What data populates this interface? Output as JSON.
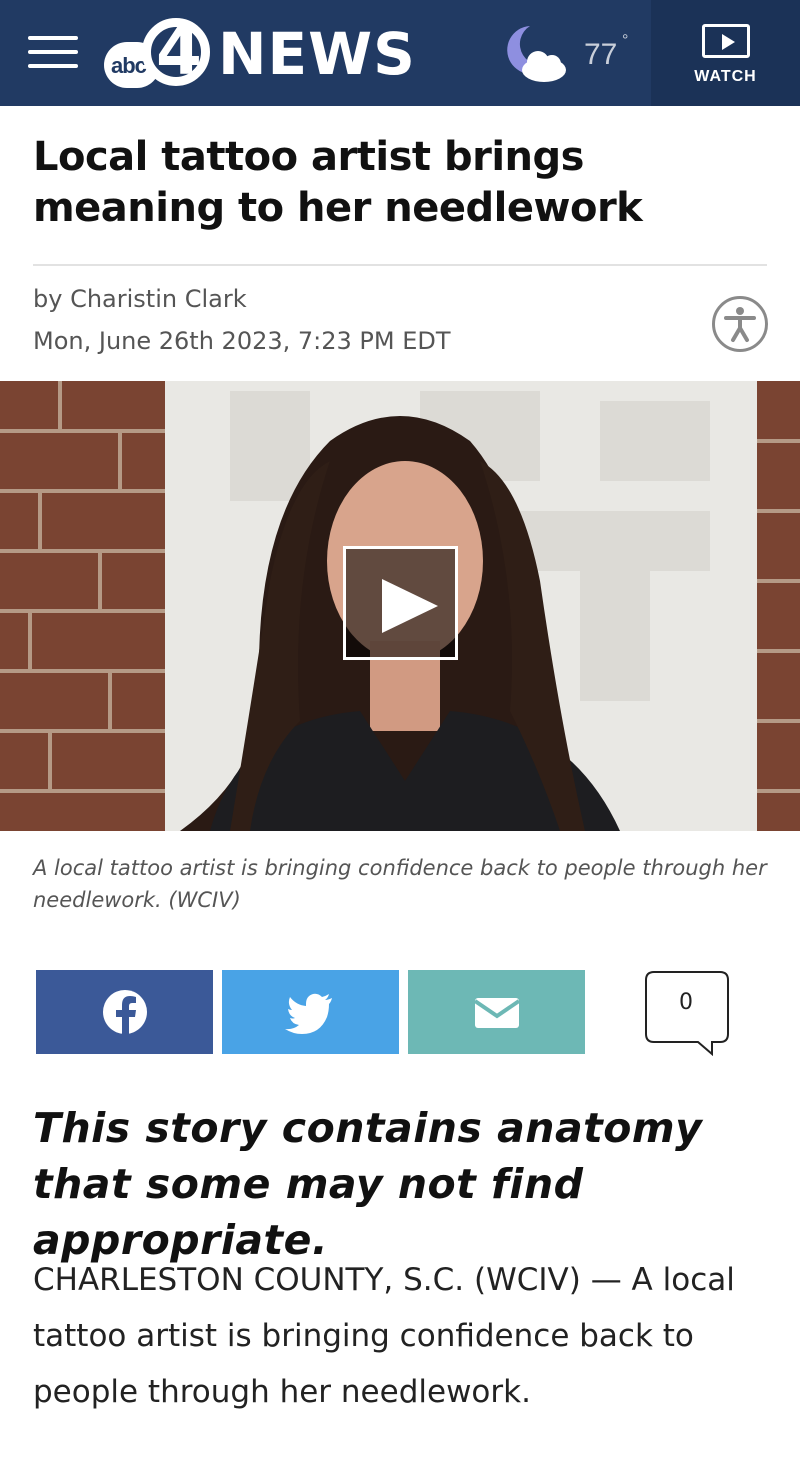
{
  "header": {
    "logo_abc": "abc",
    "logo_number": "4",
    "logo_news": "NEWS",
    "temperature": "77",
    "degree": "°",
    "weather_icon": "moon-cloud-icon",
    "watch_label": "WATCH"
  },
  "article": {
    "headline": "Local tattoo artist brings meaning to her needlework",
    "byline": "by Charistin Clark",
    "date": "Mon, June 26th 2023, 7:23 PM EDT",
    "caption": "A local tattoo artist is bringing confidence back to people through her needlework. (WCIV)",
    "warning": "This story contains anatomy that some may not find appropriate.",
    "body": "CHARLESTON COUNTY, S.C. (WCIV) — A local tattoo artist is bringing confidence back to people through her needlework."
  },
  "share": {
    "facebook_icon": "facebook-icon",
    "twitter_icon": "twitter-icon",
    "email_icon": "email-icon",
    "comment_count": "0"
  },
  "colors": {
    "header_bg": "#213a63",
    "watch_bg": "#1b3257",
    "facebook": "#3b5998",
    "twitter": "#49a3e6",
    "email": "#6db8b5"
  }
}
